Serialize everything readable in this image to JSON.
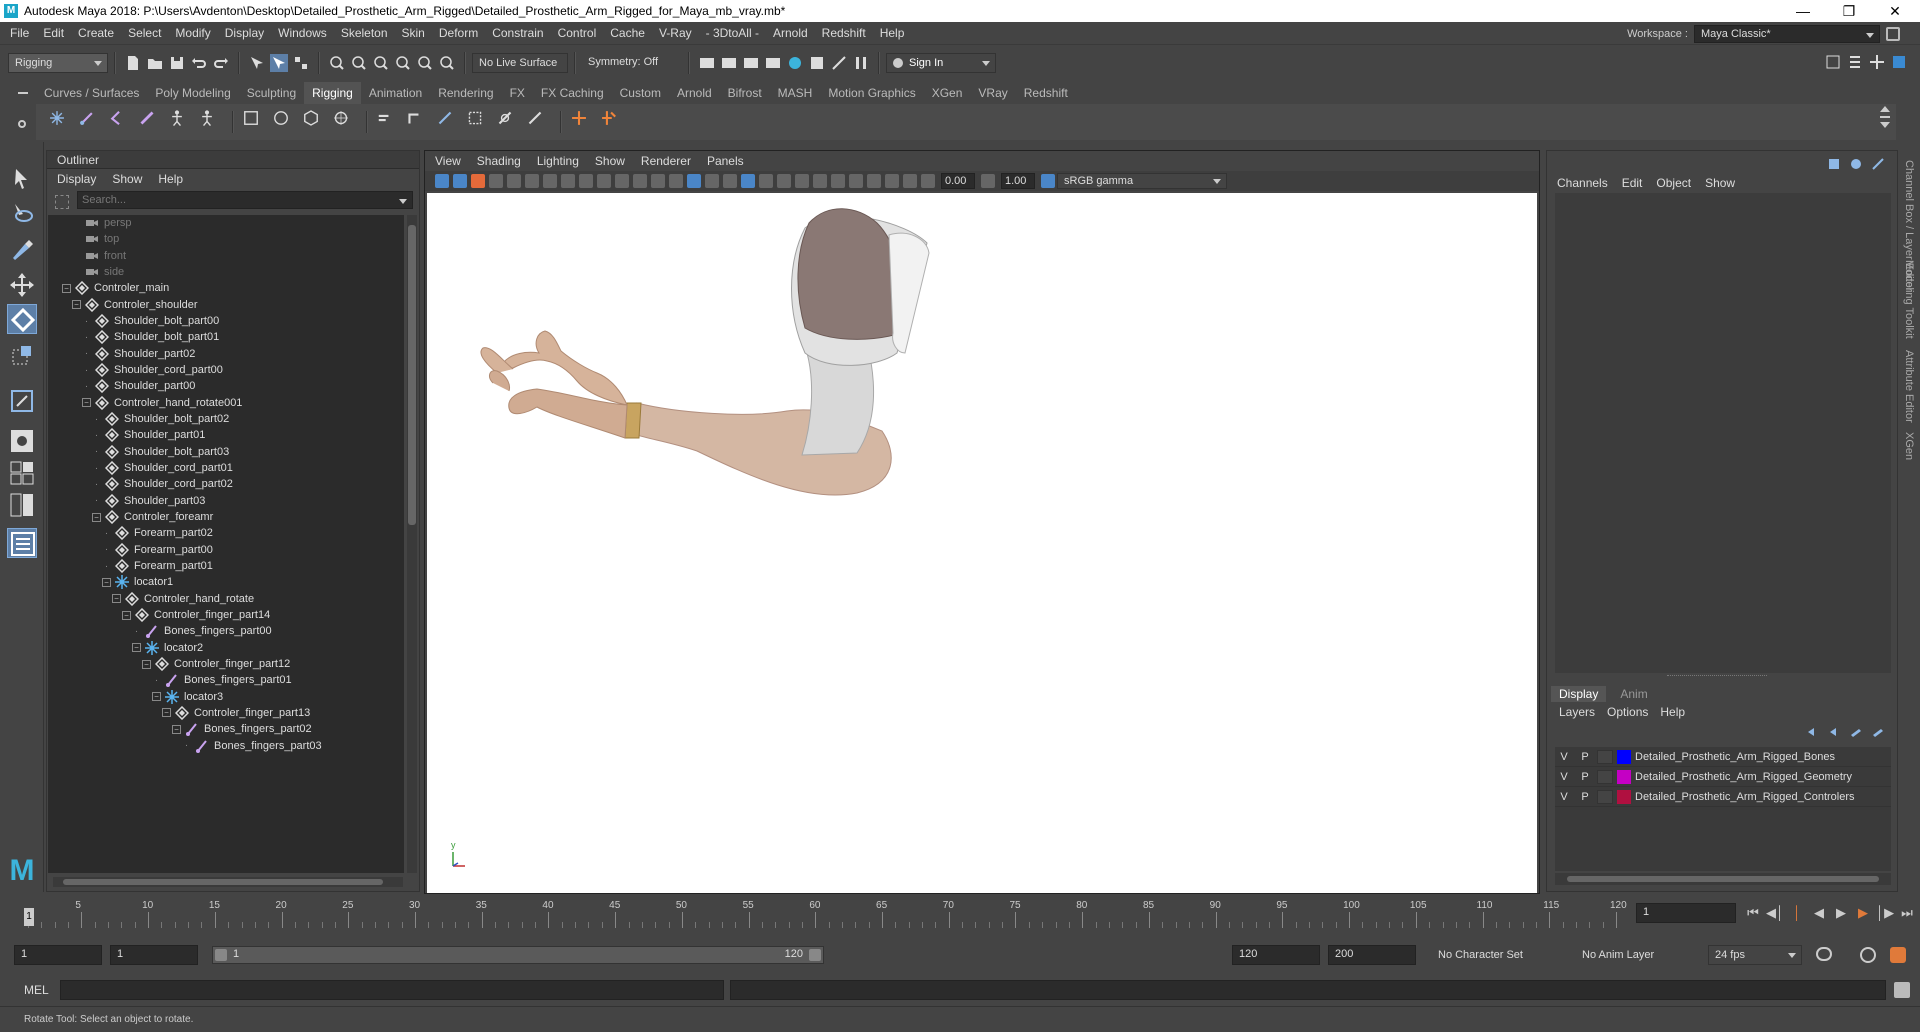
{
  "titlebar": {
    "title": "Autodesk Maya 2018: P:\\Users\\Avdenton\\Desktop\\Detailed_Prosthetic_Arm_Rigged\\Detailed_Prosthetic_Arm_Rigged_for_Maya_mb_vray.mb*"
  },
  "menu": [
    "File",
    "Edit",
    "Create",
    "Select",
    "Modify",
    "Display",
    "Windows",
    "Skeleton",
    "Skin",
    "Deform",
    "Constrain",
    "Control",
    "Cache",
    "V-Ray",
    "- 3DtoAll -",
    "Arnold",
    "Redshift",
    "Help"
  ],
  "workspace": {
    "label": "Workspace :",
    "value": "Maya Classic*"
  },
  "statusline": {
    "mode": "Rigging",
    "live_surface": "No Live Surface",
    "symmetry": "Symmetry: Off",
    "sign_in": "Sign In"
  },
  "shelf_tabs": [
    "Curves / Surfaces",
    "Poly Modeling",
    "Sculpting",
    "Rigging",
    "Animation",
    "Rendering",
    "FX",
    "FX Caching",
    "Custom",
    "Arnold",
    "Bifrost",
    "MASH",
    "Motion Graphics",
    "XGen",
    "VRay",
    "Redshift"
  ],
  "shelf_active": "Rigging",
  "outliner": {
    "title": "Outliner",
    "menu": [
      "Display",
      "Show",
      "Help"
    ],
    "search_placeholder": "Search...",
    "nodes": [
      {
        "name": "persp",
        "type": "camera",
        "depth": 1,
        "expander": "none"
      },
      {
        "name": "top",
        "type": "camera",
        "depth": 1,
        "expander": "none"
      },
      {
        "name": "front",
        "type": "camera",
        "depth": 1,
        "expander": "none"
      },
      {
        "name": "side",
        "type": "camera",
        "depth": 1,
        "expander": "none"
      },
      {
        "name": "Controler_main",
        "type": "transform",
        "depth": 0,
        "expander": "minus"
      },
      {
        "name": "Controler_shoulder",
        "type": "transform",
        "depth": 1,
        "expander": "minus"
      },
      {
        "name": "Shoulder_bolt_part00",
        "type": "transform",
        "depth": 2,
        "expander": "dot"
      },
      {
        "name": "Shoulder_bolt_part01",
        "type": "transform",
        "depth": 2,
        "expander": "dot"
      },
      {
        "name": "Shoulder_part02",
        "type": "transform",
        "depth": 2,
        "expander": "dot"
      },
      {
        "name": "Shoulder_cord_part00",
        "type": "transform",
        "depth": 2,
        "expander": "dot"
      },
      {
        "name": "Shoulder_part00",
        "type": "transform",
        "depth": 2,
        "expander": "dot"
      },
      {
        "name": "Controler_hand_rotate001",
        "type": "transform",
        "depth": 2,
        "expander": "minus"
      },
      {
        "name": "Shoulder_bolt_part02",
        "type": "transform",
        "depth": 3,
        "expander": "dot"
      },
      {
        "name": "Shoulder_part01",
        "type": "transform",
        "depth": 3,
        "expander": "dot"
      },
      {
        "name": "Shoulder_bolt_part03",
        "type": "transform",
        "depth": 3,
        "expander": "dot"
      },
      {
        "name": "Shoulder_cord_part01",
        "type": "transform",
        "depth": 3,
        "expander": "dot"
      },
      {
        "name": "Shoulder_cord_part02",
        "type": "transform",
        "depth": 3,
        "expander": "dot"
      },
      {
        "name": "Shoulder_part03",
        "type": "transform",
        "depth": 3,
        "expander": "dot"
      },
      {
        "name": "Controler_foreamr",
        "type": "transform",
        "depth": 3,
        "expander": "minus"
      },
      {
        "name": "Forearm_part02",
        "type": "transform",
        "depth": 4,
        "expander": "dot"
      },
      {
        "name": "Forearm_part00",
        "type": "transform",
        "depth": 4,
        "expander": "dot"
      },
      {
        "name": "Forearm_part01",
        "type": "transform",
        "depth": 4,
        "expander": "dot"
      },
      {
        "name": "locator1",
        "type": "locator",
        "depth": 4,
        "expander": "minus"
      },
      {
        "name": "Controler_hand_rotate",
        "type": "transform",
        "depth": 5,
        "expander": "minus"
      },
      {
        "name": "Controler_finger_part14",
        "type": "transform",
        "depth": 6,
        "expander": "minus"
      },
      {
        "name": "Bones_fingers_part00",
        "type": "joint",
        "depth": 7,
        "expander": "dot"
      },
      {
        "name": "locator2",
        "type": "locator",
        "depth": 7,
        "expander": "minus"
      },
      {
        "name": "Controler_finger_part12",
        "type": "transform",
        "depth": 8,
        "expander": "minus"
      },
      {
        "name": "Bones_fingers_part01",
        "type": "joint",
        "depth": 9,
        "expander": "dot"
      },
      {
        "name": "locator3",
        "type": "locator",
        "depth": 9,
        "expander": "minus"
      },
      {
        "name": "Controler_finger_part13",
        "type": "transform",
        "depth": 10,
        "expander": "minus"
      },
      {
        "name": "Bones_fingers_part02",
        "type": "joint",
        "depth": 11,
        "expander": "minus"
      },
      {
        "name": "Bones_fingers_part03",
        "type": "joint",
        "depth": 12,
        "expander": "dot"
      }
    ]
  },
  "viewport": {
    "menu": [
      "View",
      "Shading",
      "Lighting",
      "Show",
      "Renderer",
      "Panels"
    ],
    "exposure": "0.00",
    "gamma": "1.00",
    "color_space": "sRGB gamma",
    "axis_y_label": "y"
  },
  "channelbox": {
    "menu": [
      "Channels",
      "Edit",
      "Object",
      "Show"
    ],
    "side_tabs": [
      "Channel Box / Layer Editor",
      "Modeling Toolkit",
      "Attribute Editor",
      "XGen"
    ],
    "layer_tabs": [
      "Display",
      "Anim"
    ],
    "layer_active": "Display",
    "layer_menu": [
      "Layers",
      "Options",
      "Help"
    ],
    "layers": [
      {
        "v": "V",
        "p": "P",
        "color": "#0000ff",
        "name": "Detailed_Prosthetic_Arm_Rigged_Bones"
      },
      {
        "v": "V",
        "p": "P",
        "color": "#c400c4",
        "name": "Detailed_Prosthetic_Arm_Rigged_Geometry"
      },
      {
        "v": "V",
        "p": "P",
        "color": "#b01040",
        "name": "Detailed_Prosthetic_Arm_Rigged_Controlers"
      }
    ]
  },
  "timeline": {
    "ticks": [
      5,
      10,
      15,
      20,
      25,
      30,
      35,
      40,
      45,
      50,
      55,
      60,
      65,
      70,
      75,
      80,
      85,
      90,
      95,
      100,
      105,
      110,
      115,
      120
    ],
    "min": 1,
    "max": 120,
    "current_frame": "1",
    "current_field": "1"
  },
  "range": {
    "start": "1",
    "anim_start": "1",
    "range_start": "1",
    "range_end": "120",
    "anim_end": "120",
    "end": "200",
    "character_set": "No Character Set",
    "anim_layer": "No Anim Layer",
    "fps": "24 fps"
  },
  "cmdline": {
    "label": "MEL"
  },
  "helpline": {
    "text": "Rotate Tool: Select an object to rotate."
  }
}
